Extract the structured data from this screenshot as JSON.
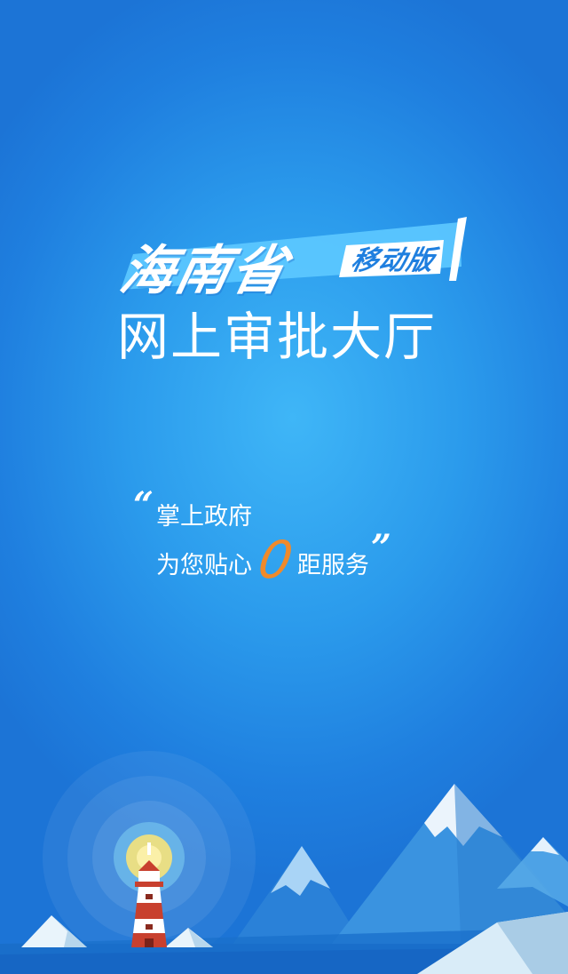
{
  "logo": {
    "province": "海南省",
    "badge": "移动版",
    "title": "网上审批大厅"
  },
  "slogan": {
    "quote_open": "“",
    "line1": "掌上政府",
    "line2_before": "为您贴心",
    "zero": "0",
    "line2_after": "距服务",
    "quote_close": "”"
  },
  "icons": [
    "lighthouse-icon",
    "mountain-icon",
    "snow-peak-icon"
  ],
  "colors": {
    "background_center": "#3fb6f7",
    "background_edge": "#1c74d6",
    "banner": "#5cc8ff",
    "badge": "#ffffff",
    "accent_zero": "#f08a2a",
    "lighthouse_red": "#c8402e",
    "beacon_yellow": "#f6e27a"
  }
}
